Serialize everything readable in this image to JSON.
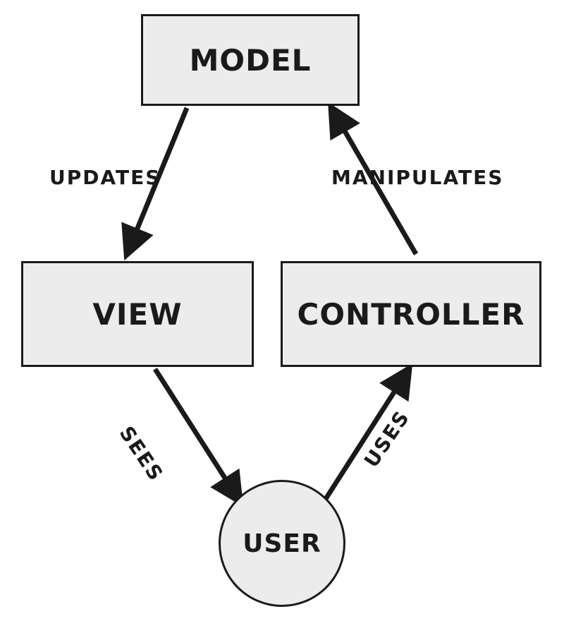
{
  "nodes": {
    "model": "MODEL",
    "view": "VIEW",
    "controller": "CONTROLLER",
    "user": "USER"
  },
  "edges": {
    "model_to_view": "UPDATES",
    "controller_to_model": "MANIPULATES",
    "user_from_view": "SEES",
    "user_to_controller": "USES"
  },
  "colors": {
    "box_fill": "#ececec",
    "stroke": "#1a1a1a",
    "text": "#1a1a1a"
  }
}
